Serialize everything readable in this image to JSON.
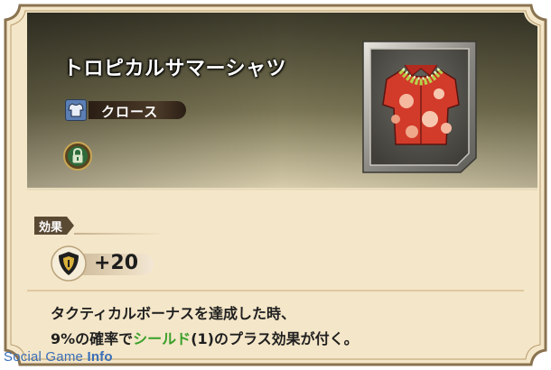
{
  "item": {
    "name": "トロピカルサマーシャツ",
    "category_icon": "shirt-icon",
    "category": "クロース",
    "lock_icon": "padlock-icon"
  },
  "effect": {
    "tag": "効果",
    "stat_icon": "shield-icon",
    "stat_value": "+20",
    "desc_line1": "タクティカルボーナスを達成した時、",
    "desc_line2_pre": "9%の確率で",
    "desc_line2_highlight": "シールド",
    "desc_line2_post": "(1)のプラス効果が付く。"
  },
  "watermark": {
    "prefix": "Social Game",
    "suffix": "Info"
  },
  "colors": {
    "header_dark": "#4a4632",
    "panel_light": "#f4e6c8",
    "frame": "#8a7350",
    "highlight_text": "#3aa02a",
    "watermark": "#3a6fb8"
  }
}
